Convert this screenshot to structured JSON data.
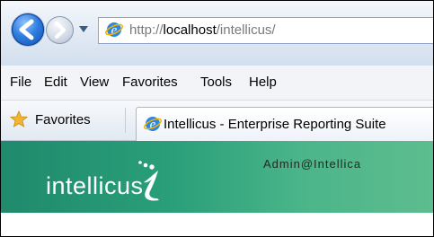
{
  "browser": {
    "address": {
      "protocol": "http://",
      "host": "localhost",
      "path": "/intellicus/"
    },
    "menu": [
      "File",
      "Edit",
      "View",
      "Favorites",
      "Tools",
      "Help"
    ],
    "favorites_label": "Favorites",
    "tab_title": "Intellicus - Enterprise Reporting Suite"
  },
  "app": {
    "logo_text": "intellicus",
    "user": "Admin@Intellica"
  },
  "colors": {
    "banner_start": "#1f8a6c",
    "banner_end": "#5dbd8f"
  },
  "icons": [
    "back-icon",
    "forward-icon",
    "ie-icon",
    "star-icon"
  ]
}
